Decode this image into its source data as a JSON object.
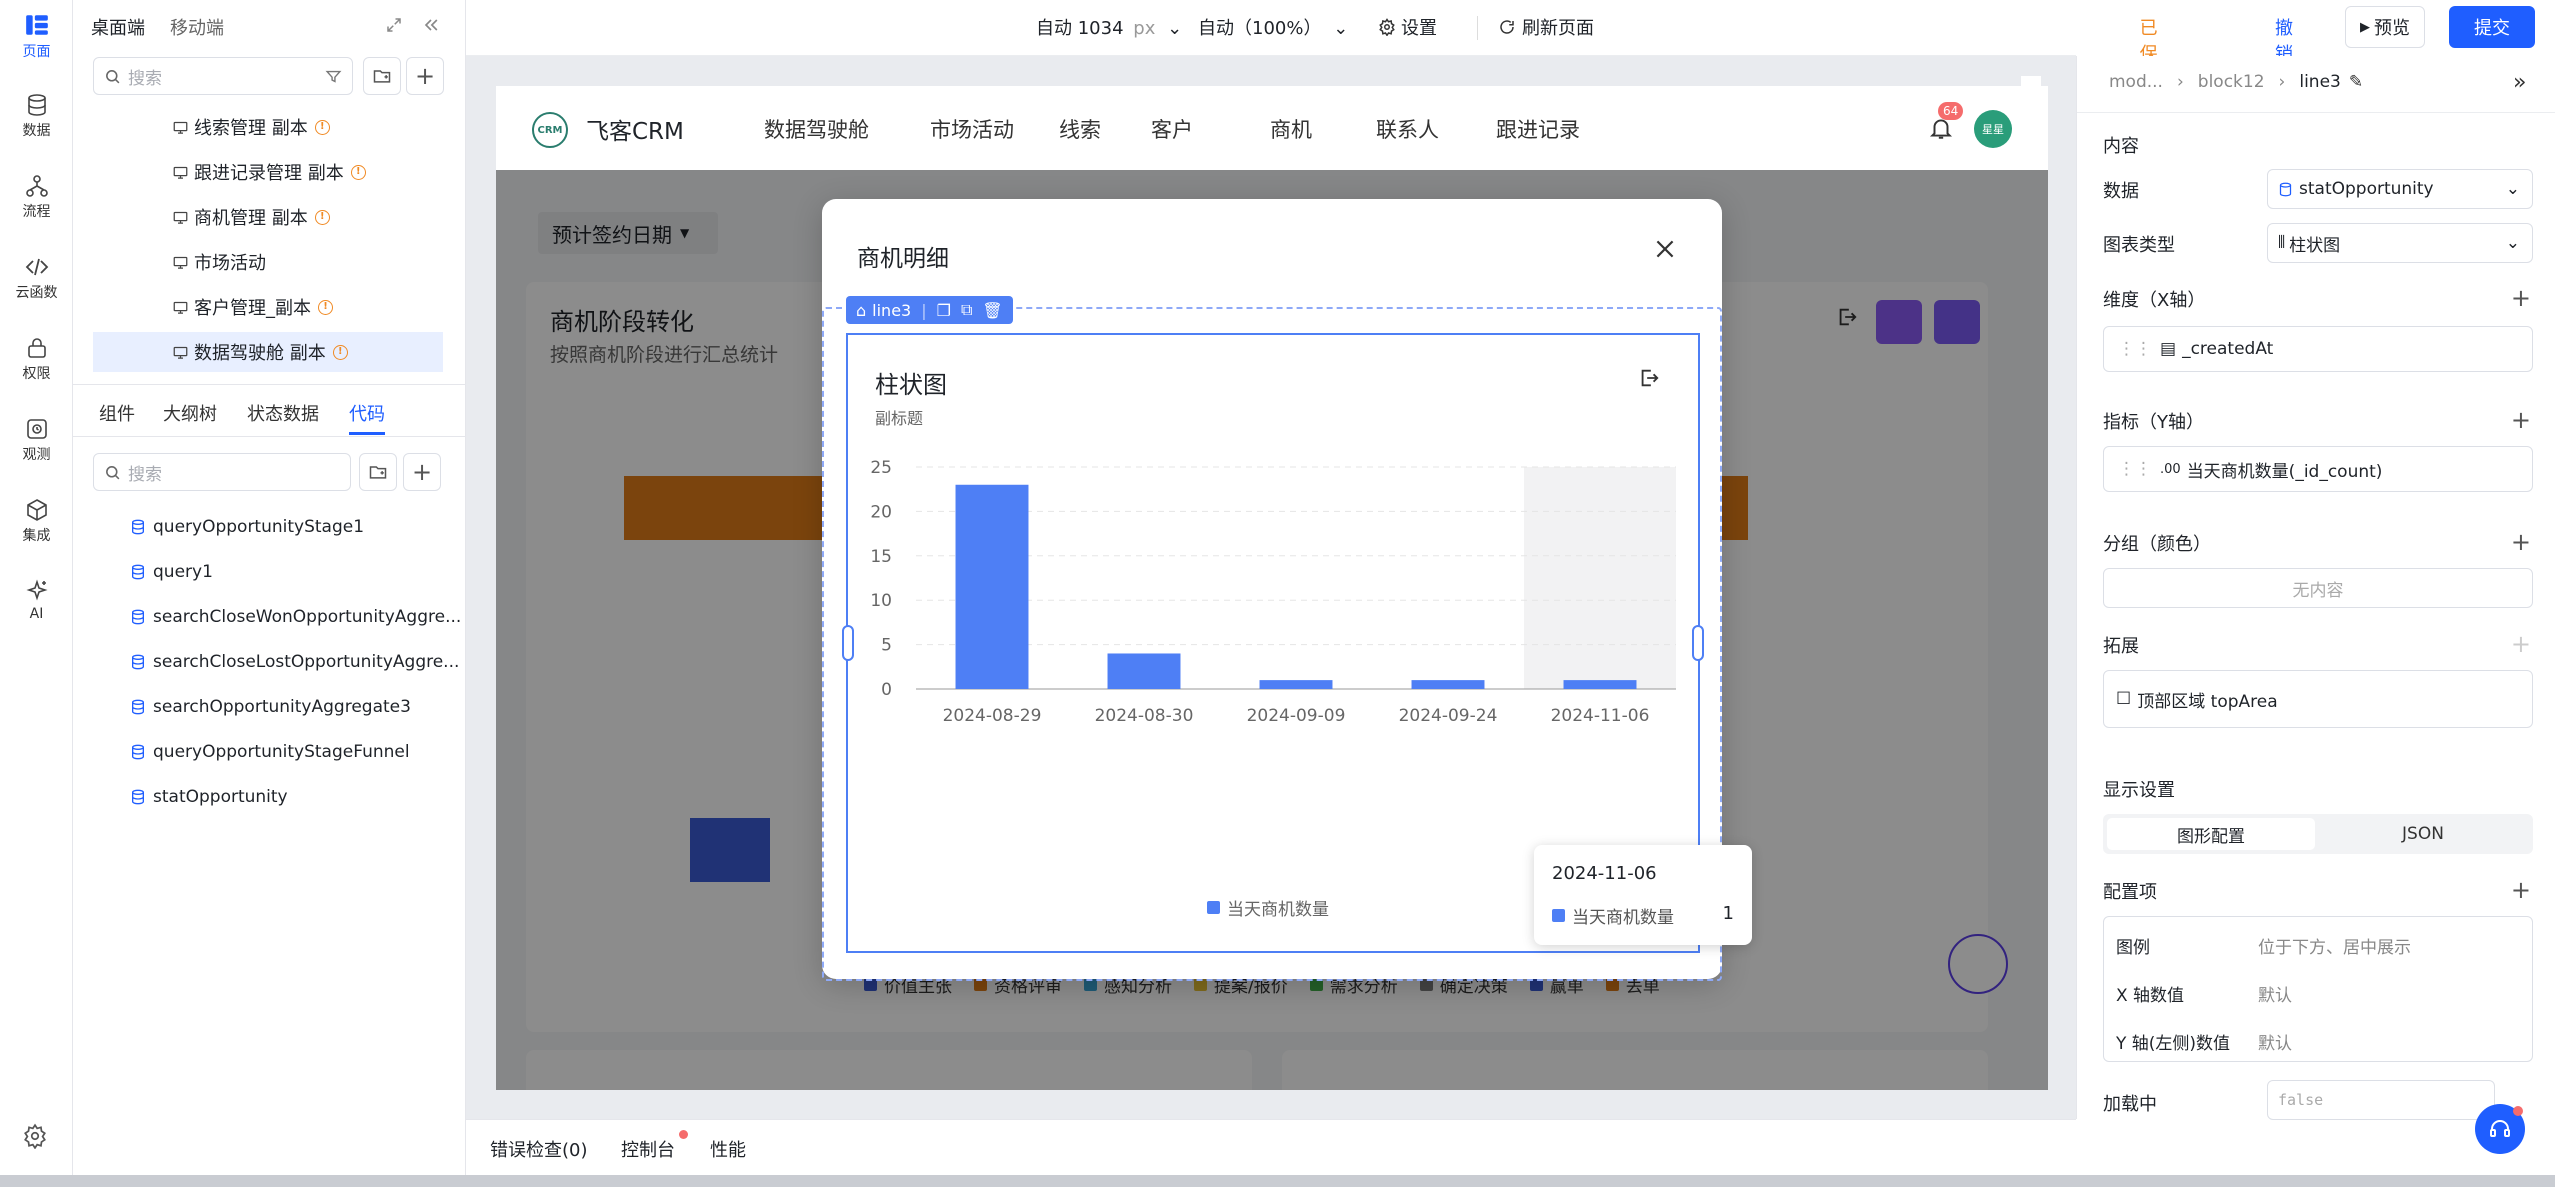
{
  "rail": {
    "items": [
      {
        "label": "页面",
        "icon": "pages-icon"
      },
      {
        "label": "数据",
        "icon": "database-icon"
      },
      {
        "label": "流程",
        "icon": "flow-icon"
      },
      {
        "label": "云函数",
        "icon": "code-icon"
      },
      {
        "label": "权限",
        "icon": "lock-icon"
      },
      {
        "label": "观测",
        "icon": "monitor-icon"
      },
      {
        "label": "集成",
        "icon": "cube-icon"
      },
      {
        "label": "AI",
        "icon": "sparkle-icon"
      }
    ]
  },
  "left_panel": {
    "tabs_top": [
      "桌面端",
      "移动端"
    ],
    "search_placeholder": "搜索",
    "pages": [
      {
        "label": "线索管理 副本",
        "warn": "!"
      },
      {
        "label": "跟进记录管理 副本",
        "warn": "!"
      },
      {
        "label": "商机管理 副本",
        "warn": "!"
      },
      {
        "label": "市场活动",
        "warn": ""
      },
      {
        "label": "客户管理_副本",
        "warn": "!"
      },
      {
        "label": "数据驾驶舱 副本",
        "warn": "!"
      }
    ],
    "tabs": [
      "组件",
      "大纲树",
      "状态数据",
      "代码"
    ],
    "code_search_placeholder": "搜索",
    "code_items": [
      "queryOpportunityStage1",
      "query1",
      "searchCloseWonOpportunityAggre...",
      "searchCloseLostOpportunityAggre...",
      "searchOpportunityAggregate3",
      "queryOpportunityStageFunnel",
      "statOpportunity"
    ]
  },
  "topbar": {
    "width_value": "自动 1034",
    "width_unit": "px",
    "zoom": "自动（100%）",
    "settings": "设置",
    "refresh": "刷新页面",
    "unsaved": "已保存未提交",
    "revoke": "撤销",
    "preview": "预览",
    "submit": "提交"
  },
  "app": {
    "logo": "CRM",
    "title": "飞客CRM",
    "nav": [
      "数据驾驶舱",
      "市场活动",
      "线索",
      "客户",
      "商机",
      "联系人",
      "跟进记录"
    ],
    "badge": "64",
    "avatar": "星星",
    "filter": "预计签约日期",
    "card_title": "商机阶段转化",
    "card_sub": "按照商机阶段进行汇总统计",
    "bottom_legend": [
      {
        "name": "价值主张",
        "color": "#3b5bd6"
      },
      {
        "name": "资格评审",
        "color": "#e07d18"
      },
      {
        "name": "感知分析",
        "color": "#3aa6d8"
      },
      {
        "name": "提案/报价",
        "color": "#e8c235"
      },
      {
        "name": "需求分析",
        "color": "#43b04a"
      },
      {
        "name": "确定决策",
        "color": "#7d7d7d"
      },
      {
        "name": "赢单",
        "color": "#3b5bd6"
      },
      {
        "name": "丢单",
        "color": "#e07d18"
      }
    ]
  },
  "modal": {
    "title": "商机明细",
    "tag": "line3",
    "chart_title": "柱状图",
    "chart_subtitle": "副标题",
    "tooltip_date": "2024-11-06",
    "tooltip_series": "当天商机数量",
    "tooltip_value": "1"
  },
  "chart_data": {
    "type": "bar",
    "title": "柱状图",
    "subtitle": "副标题",
    "categories": [
      "2024-08-29",
      "2024-08-30",
      "2024-09-09",
      "2024-09-24",
      "2024-11-06"
    ],
    "series": [
      {
        "name": "当天商机数量",
        "values": [
          23,
          4,
          1,
          1,
          1
        ]
      }
    ],
    "ylim": [
      0,
      25
    ],
    "yticks": [
      0,
      5,
      10,
      15,
      20,
      25
    ],
    "highlighted_category": "2024-11-06",
    "legend_position": "bottom-center",
    "grid": true,
    "color": "#4e7ff5"
  },
  "right_panel": {
    "breadcrumb": [
      "mod...",
      "block12",
      "line3"
    ],
    "section_content": "内容",
    "data_label": "数据",
    "data_value": "statOpportunity",
    "chart_type_label": "图表类型",
    "chart_type_value": "柱状图",
    "x_label": "维度（X轴）",
    "x_value": "_createdAt",
    "y_label": "指标（Y轴）",
    "y_prefix": ".00",
    "y_value": "当天商机数量(_id_count)",
    "group_label": "分组（颜色）",
    "group_value": "无内容",
    "ext_label": "拓展",
    "ext_value": "顶部区域 topArea",
    "display_label": "显示设置",
    "seg": [
      "图形配置",
      "JSON"
    ],
    "config_label": "配置项",
    "config_rows": [
      {
        "k": "图例",
        "v": "位于下方、居中展示"
      },
      {
        "k": "X 轴数值",
        "v": "默认"
      },
      {
        "k": "Y 轴(左侧)数值",
        "v": "默认"
      }
    ],
    "loading_label": "加载中",
    "loading_value": "false"
  },
  "bottom": {
    "tabs": [
      "错误检查(0)",
      "控制台",
      "性能"
    ]
  }
}
